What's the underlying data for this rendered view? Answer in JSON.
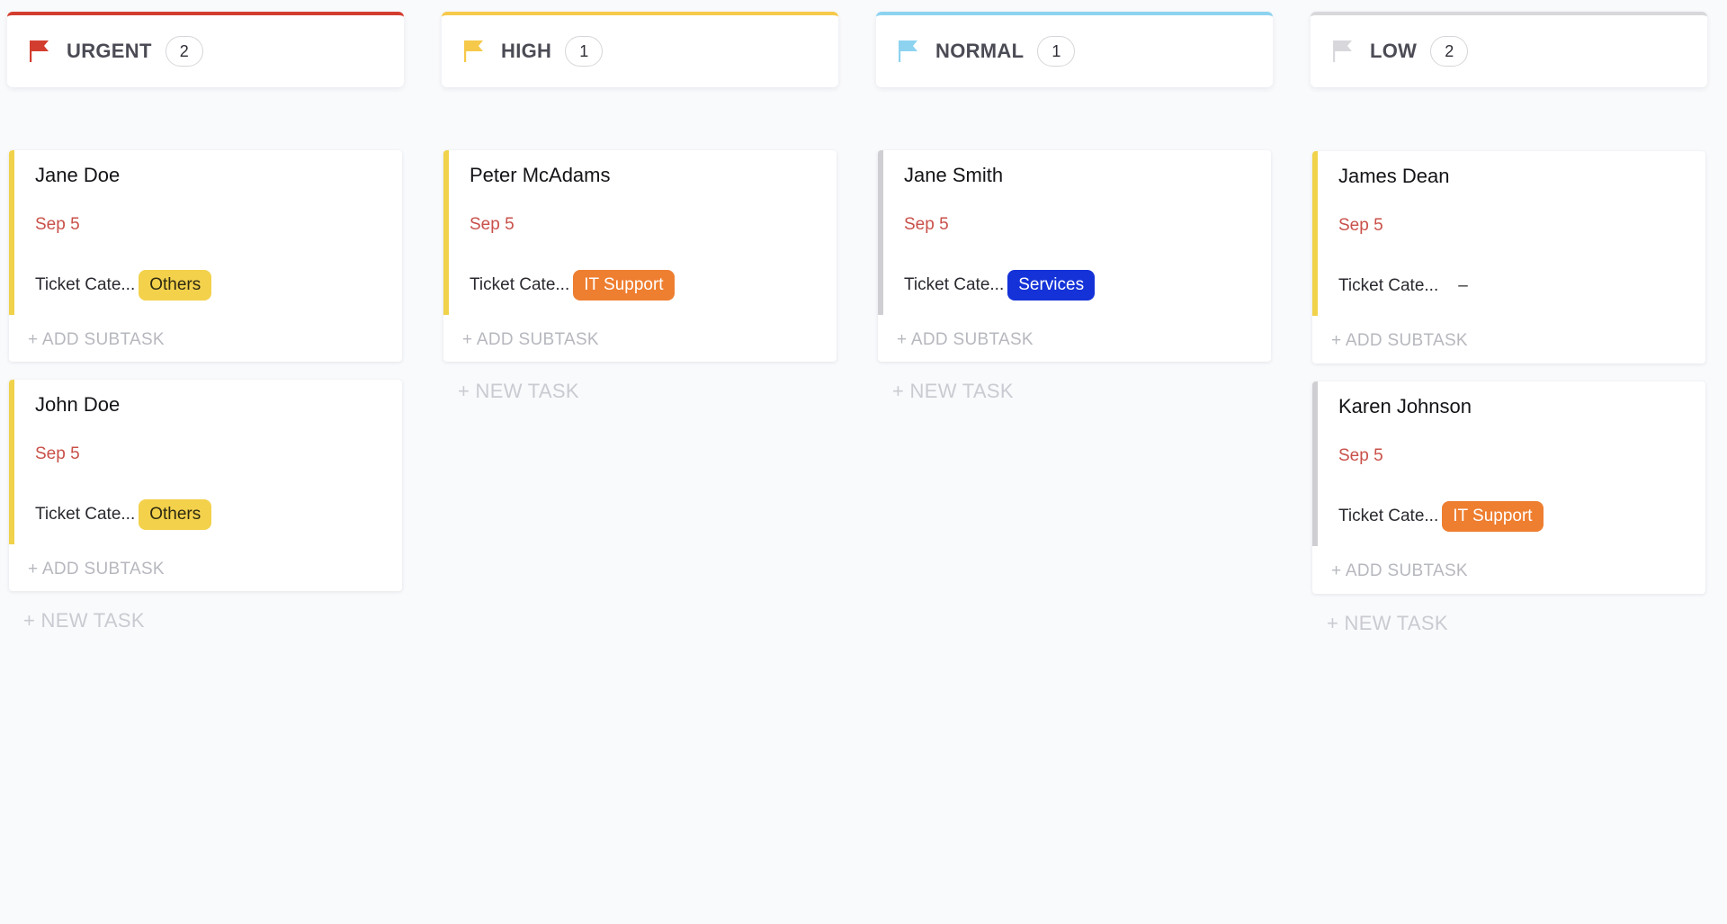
{
  "columns": [
    {
      "title": "URGENT",
      "count": "2",
      "accent": "#d33d2f",
      "flag_icon": "flag-icon",
      "cards": [
        {
          "name": "Jane Doe",
          "date": "Sep 5",
          "field_label": "Ticket Cate...",
          "tag": "Others",
          "tag_bg": "#f3d14b",
          "tag_fg": "#2e2a12",
          "stripe": "#f0d24b",
          "add_subtask": "+ ADD SUBTASK"
        },
        {
          "name": "John Doe",
          "date": "Sep 5",
          "field_label": "Ticket Cate...",
          "tag": "Others",
          "tag_bg": "#f3d14b",
          "tag_fg": "#2e2a12",
          "stripe": "#f0d24b",
          "add_subtask": "+ ADD SUBTASK"
        }
      ],
      "new_task": "+ NEW TASK"
    },
    {
      "title": "HIGH",
      "count": "1",
      "accent": "#f6c94a",
      "flag_icon": "flag-icon",
      "cards": [
        {
          "name": "Peter McAdams",
          "date": "Sep 5",
          "field_label": "Ticket Cate...",
          "tag": "IT Support",
          "tag_bg": "#ee7e30",
          "tag_fg": "#ffffff",
          "stripe": "#f0d24b",
          "add_subtask": "+ ADD SUBTASK"
        }
      ],
      "new_task": "+ NEW TASK"
    },
    {
      "title": "NORMAL",
      "count": "1",
      "accent": "#8dd3f0",
      "flag_icon": "flag-icon",
      "cards": [
        {
          "name": "Jane Smith",
          "date": "Sep 5",
          "field_label": "Ticket Cate...",
          "tag": "Services",
          "tag_bg": "#1432d8",
          "tag_fg": "#ffffff",
          "stripe": "#cfcfd3",
          "add_subtask": "+ ADD SUBTASK"
        }
      ],
      "new_task": "+ NEW TASK"
    },
    {
      "title": "LOW",
      "count": "2",
      "accent": "#d8d8dc",
      "flag_icon": "flag-icon",
      "cards": [
        {
          "name": "James Dean",
          "date": "Sep 5",
          "field_label": "Ticket Cate...",
          "tag": "–",
          "tag_bg": "",
          "tag_fg": "#333333",
          "stripe": "#f0d24b",
          "add_subtask": "+ ADD SUBTASK"
        },
        {
          "name": "Karen Johnson",
          "date": "Sep 5",
          "field_label": "Ticket Cate...",
          "tag": "IT Support",
          "tag_bg": "#ee7e30",
          "tag_fg": "#ffffff",
          "stripe": "#cfcfd3",
          "add_subtask": "+ ADD SUBTASK"
        }
      ],
      "new_task": "+ NEW TASK"
    }
  ]
}
